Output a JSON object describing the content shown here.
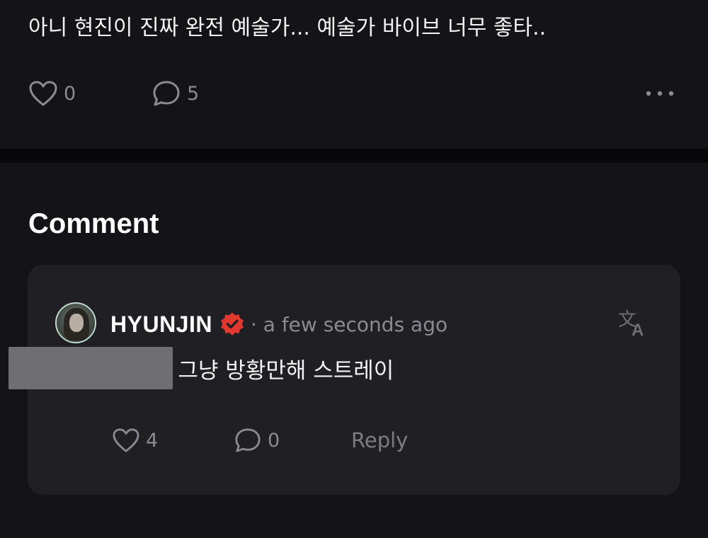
{
  "post": {
    "text": "아니 현진이 진짜 완전 예술가... 예술가 바이브 너무 좋타..",
    "like_count": "0",
    "comment_count": "5",
    "icons": {
      "like": "heart-icon",
      "comment": "speech-bubble-icon",
      "more": "more-horizontal-icon"
    }
  },
  "comments_section": {
    "title": "Comment"
  },
  "comment": {
    "author": "HYUNJIN",
    "verified": true,
    "verified_badge_color": "#e2382f",
    "timestamp": "· a few seconds ago",
    "body": "아니야 그냥 방황만해 스트레이",
    "like_count": "4",
    "comment_count": "0",
    "reply_label": "Reply",
    "icons": {
      "avatar": "avatar-image",
      "translate": "translate-icon",
      "like": "heart-icon",
      "comment": "speech-bubble-icon"
    }
  },
  "colors": {
    "background": "#141418",
    "card": "#1f1f24",
    "muted_text": "#8a8a92",
    "primary_text": "#ffffff"
  }
}
